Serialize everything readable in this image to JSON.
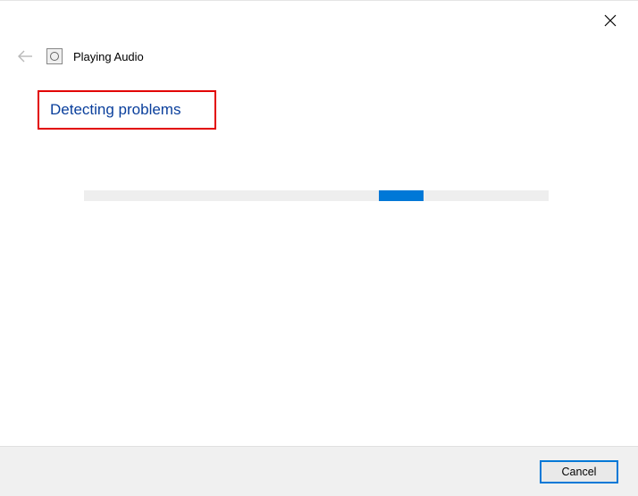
{
  "window": {
    "title": "Playing Audio",
    "status": "Detecting problems"
  },
  "buttons": {
    "cancel": "Cancel"
  },
  "icons": {
    "back": "back-arrow",
    "close": "close",
    "troubleshooter": "troubleshooter"
  },
  "highlight": {
    "color": "#e20000"
  },
  "progress": {
    "indeterminate": true
  }
}
